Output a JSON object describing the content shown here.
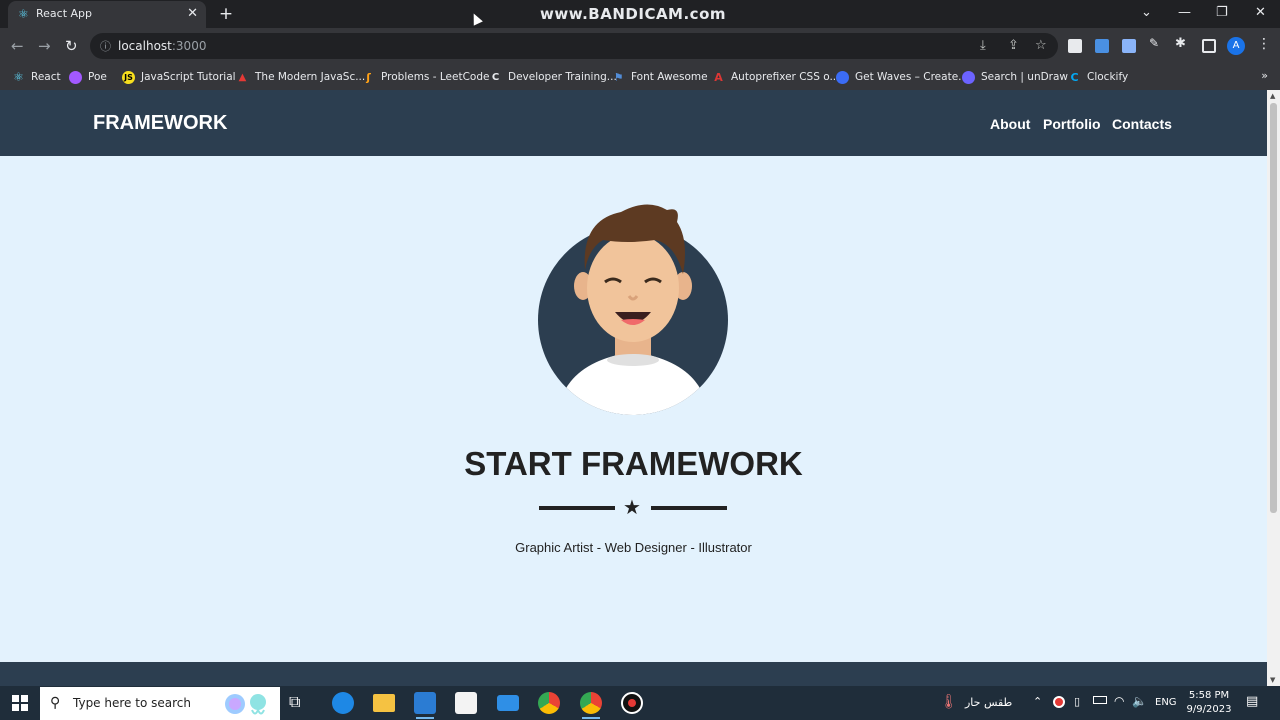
{
  "browser": {
    "tab_title": "React App",
    "watermark": "www.BANDICAM.com",
    "url_host": "localhost",
    "url_port": ":3000",
    "profile_initial": "A"
  },
  "bookmarks": [
    {
      "label": "React",
      "icon": "react-icon",
      "color": "#61dafb"
    },
    {
      "label": "Poe",
      "icon": "poe-icon",
      "color": "#a259ff"
    },
    {
      "label": "JavaScript Tutorial",
      "icon": "js-icon",
      "color": "#f7df1e"
    },
    {
      "label": "The Modern JavaSc...",
      "icon": "modern-js-icon",
      "color": "#e53935"
    },
    {
      "label": "Problems - LeetCode",
      "icon": "leetcode-icon",
      "color": "#ffa116"
    },
    {
      "label": "Developer Training...",
      "icon": "codecademy-icon",
      "color": "#e8eaed"
    },
    {
      "label": "Font Awesome",
      "icon": "flag-icon",
      "color": "#528dd7"
    },
    {
      "label": "Autoprefixer CSS o...",
      "icon": "autoprefixer-icon",
      "color": "#dd3735"
    },
    {
      "label": "Get Waves – Create...",
      "icon": "waves-icon",
      "color": "#3b6cf5"
    },
    {
      "label": "Search | unDraw",
      "icon": "undraw-icon",
      "color": "#6c63ff"
    },
    {
      "label": "Clockify",
      "icon": "clockify-icon",
      "color": "#03a9f4"
    }
  ],
  "site": {
    "brand": "FRAMEWORK",
    "nav": [
      "About",
      "Portfolio",
      "Contacts"
    ],
    "hero_title": "START FRAMEWORK",
    "hero_subtitle": "Graphic Artist - Web Designer - Illustrator"
  },
  "taskbar": {
    "search_placeholder": "Type here to search",
    "weather": "طقس حار",
    "lang": "ENG",
    "time": "5:58 PM",
    "date": "9/9/2023"
  },
  "colors": {
    "navbar": "#2c3e50",
    "hero_bg": "#e3f2fd",
    "text_dark": "#222222"
  }
}
